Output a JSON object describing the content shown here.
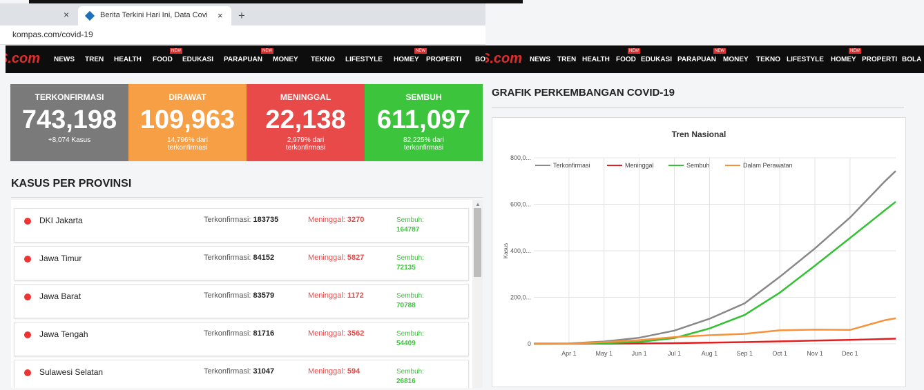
{
  "browser": {
    "tab_title": "Berita Terkini Hari Ini, Data Covid",
    "tab_close": "×",
    "new_tab": "+",
    "url": "kompas.com/covid-19"
  },
  "nav": {
    "logo": "S.com",
    "logo_right": "S.com",
    "badge": "NEW",
    "items": [
      "NEWS",
      "TREN",
      "HEALTH",
      "FOOD",
      "EDUKASI",
      "PARAPUAN",
      "MONEY",
      "TEKNO",
      "LIFESTYLE",
      "HOMEY",
      "PROPERTI",
      "BOLA"
    ]
  },
  "stats": [
    {
      "label": "TERKONFIRMASI",
      "value": "743,198",
      "sub1": "+8,074 Kasus",
      "sub2": "",
      "color": "#7a7a7a"
    },
    {
      "label": "DIRAWAT",
      "value": "109,963",
      "sub1": "14,796% dari",
      "sub2": "terkonfirmasi",
      "color": "#f79f44"
    },
    {
      "label": "MENINGGAL",
      "value": "22,138",
      "sub1": "2,979% dari",
      "sub2": "terkonfirmasi",
      "color": "#e84a4a"
    },
    {
      "label": "SEMBUH",
      "value": "611,097",
      "sub1": "82,225% dari",
      "sub2": "terkonfirmasi",
      "color": "#3cc43c"
    }
  ],
  "provinces": {
    "heading": "KASUS PER PROVINSI",
    "conf_label": "Terkonfirmasi:",
    "death_label": "Meninggal:",
    "rec_label": "Sembuh:",
    "rows": [
      {
        "name": "DKI Jakarta",
        "confirmed": "183735",
        "deaths": "3270",
        "recovered": "164787"
      },
      {
        "name": "Jawa Timur",
        "confirmed": "84152",
        "deaths": "5827",
        "recovered": "72135"
      },
      {
        "name": "Jawa Barat",
        "confirmed": "83579",
        "deaths": "1172",
        "recovered": "70788"
      },
      {
        "name": "Jawa Tengah",
        "confirmed": "81716",
        "deaths": "3562",
        "recovered": "54409"
      },
      {
        "name": "Sulawesi Selatan",
        "confirmed": "31047",
        "deaths": "594",
        "recovered": "26816"
      }
    ]
  },
  "chart_heading": "GRAFIK PERKEMBANGAN COVID-19",
  "chart_data": {
    "type": "line",
    "title": "Tren Nasional",
    "ylabel": "Kasus",
    "xlabel": "",
    "ylim": [
      0,
      800000
    ],
    "y_ticks": [
      0,
      200000,
      400000,
      600000,
      800000
    ],
    "y_tick_labels": [
      "0",
      "200,0...",
      "400,0...",
      "600,0...",
      "800,0..."
    ],
    "x_tick_labels": [
      "Apr 1",
      "May 1",
      "Jun 1",
      "Jul 1",
      "Aug 1",
      "Sep 1",
      "Oct 1",
      "Nov 1",
      "Dec 1"
    ],
    "x_tick_months": [
      1,
      2,
      3,
      4,
      5,
      6,
      7,
      8,
      9
    ],
    "x_range_months": [
      0,
      10.3
    ],
    "grid": true,
    "legend_position": "top",
    "series": [
      {
        "name": "Terkonfirmasi",
        "color": "#888888",
        "x": [
          0,
          1,
          2,
          3,
          4,
          5,
          6,
          7,
          8,
          9,
          10,
          10.3
        ],
        "y": [
          1500,
          1700,
          10000,
          26000,
          57000,
          108000,
          174000,
          288000,
          410000,
          543000,
          700000,
          743198
        ]
      },
      {
        "name": "Meninggal",
        "color": "#e02020",
        "x": [
          0,
          1,
          2,
          3,
          4,
          5,
          6,
          7,
          8,
          9,
          10,
          10.3
        ],
        "y": [
          100,
          200,
          800,
          1600,
          2900,
          5200,
          7500,
          10600,
          14000,
          17000,
          21000,
          22138
        ]
      },
      {
        "name": "Sembuh",
        "color": "#33c033",
        "x": [
          0,
          1,
          2,
          3,
          4,
          5,
          6,
          7,
          8,
          9,
          10,
          10.3
        ],
        "y": [
          100,
          300,
          2300,
          8000,
          25000,
          66000,
          124000,
          220000,
          336000,
          455000,
          575000,
          611097
        ]
      },
      {
        "name": "Dalam Perawatan",
        "color": "#f7923a",
        "x": [
          0,
          1,
          2,
          3,
          4,
          5,
          6,
          7,
          8,
          9,
          10,
          10.3
        ],
        "y": [
          1300,
          1200,
          7000,
          16000,
          29000,
          37000,
          43000,
          58000,
          61000,
          60000,
          102000,
          109963
        ]
      }
    ]
  }
}
